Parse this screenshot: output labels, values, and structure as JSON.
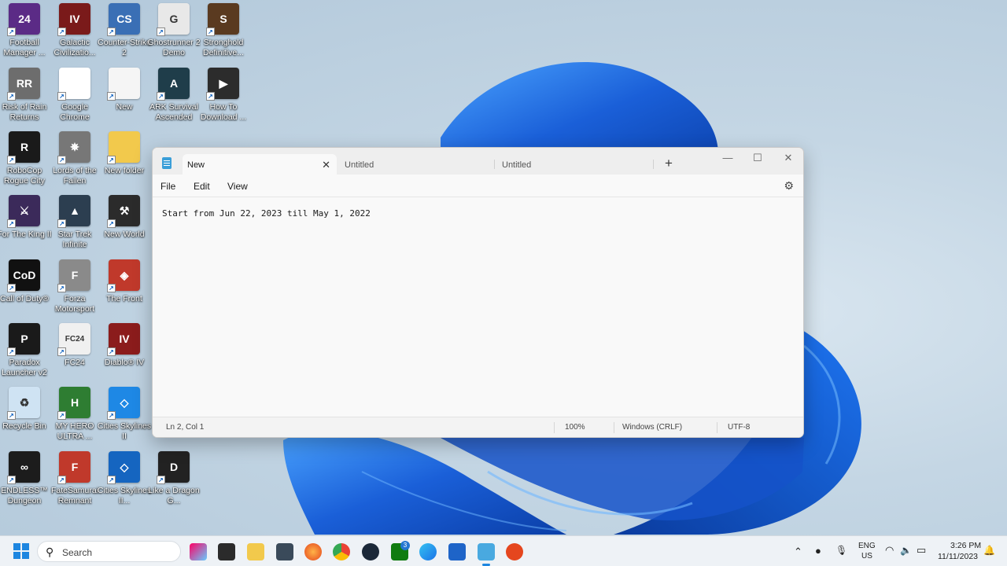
{
  "desktop": {
    "icons": [
      {
        "label": "Football Manager ...",
        "color": "#5b2b86",
        "glyph": "24"
      },
      {
        "label": "Galactic Civilizatio...",
        "color": "#7a1a1a",
        "glyph": "IV"
      },
      {
        "label": "Counter-Strike 2",
        "color": "#3a6fb5",
        "glyph": "CS"
      },
      {
        "label": "Ghostrunner 2 Demo",
        "color": "#e8e8e8",
        "glyph": "G"
      },
      {
        "label": "Stronghold Definitive...",
        "color": "#5a3a20",
        "glyph": "S"
      },
      {
        "label": "Risk of Rain Returns",
        "color": "#6d6d6d",
        "glyph": "RR"
      },
      {
        "label": "Google Chrome",
        "color": "#ffffff",
        "glyph": ""
      },
      {
        "label": "New",
        "color": "#f5f5f5",
        "glyph": ""
      },
      {
        "label": "ARK Survival Ascended",
        "color": "#1f3d4a",
        "glyph": "A"
      },
      {
        "label": "How To Download ...",
        "color": "#2c2c2c",
        "glyph": "▶"
      },
      {
        "label": "RoboCop Rogue City",
        "color": "#1a1a1a",
        "glyph": "R"
      },
      {
        "label": "Lords of the Fallen",
        "color": "#777777",
        "glyph": "✵"
      },
      {
        "label": "New folder",
        "color": "#f2c94c",
        "glyph": ""
      },
      {
        "label": "For The King II",
        "color": "#3b2a5a",
        "glyph": "⚔"
      },
      {
        "label": "Star Trek Infinite",
        "color": "#2c3e50",
        "glyph": "▲"
      },
      {
        "label": "New World",
        "color": "#2b2b2b",
        "glyph": "⚒"
      },
      {
        "label": "Call of Duty®",
        "color": "#111111",
        "glyph": "CoD"
      },
      {
        "label": "Forza Motorsport",
        "color": "#8a8a8a",
        "glyph": "F"
      },
      {
        "label": "The Front",
        "color": "#c0392b",
        "glyph": "◈"
      },
      {
        "label": "Paradox Launcher v2",
        "color": "#1a1a1a",
        "glyph": "P"
      },
      {
        "label": "FC24",
        "color": "#f0f0f0",
        "glyph": "FC24"
      },
      {
        "label": "Diablo® IV",
        "color": "#8b1c1c",
        "glyph": "IV"
      },
      {
        "label": "Recycle Bin",
        "color": "#cfe3f3",
        "glyph": "♻"
      },
      {
        "label": "MY HERO ULTRA ...",
        "color": "#2e7d32",
        "glyph": "H"
      },
      {
        "label": "Cities Skylines II",
        "color": "#1e88e5",
        "glyph": "◇"
      },
      {
        "label": "ENDLESS™ Dungeon",
        "color": "#1c1c1c",
        "glyph": "∞"
      },
      {
        "label": "FateSamurai Remnant",
        "color": "#c0392b",
        "glyph": "F"
      },
      {
        "label": "Cities Skylines II...",
        "color": "#1565c0",
        "glyph": "◇"
      },
      {
        "label": "Like a Dragon G...",
        "color": "#222222",
        "glyph": "D"
      }
    ]
  },
  "notepad": {
    "tabs": [
      "New",
      "Untitled",
      "Untitled"
    ],
    "tab_close": "✕",
    "new_tab": "+",
    "window_controls": {
      "minimize": "—",
      "maximize": "☐",
      "close": "✕"
    },
    "menu": {
      "file": "File",
      "edit": "Edit",
      "view": "View"
    },
    "settings_icon": "⚙",
    "content": "Start from Jun 22, 2023 till May 1, 2022",
    "status": {
      "position": "Ln 2, Col 1",
      "zoom": "100%",
      "line_ending": "Windows (CRLF)",
      "encoding": "UTF-8"
    }
  },
  "taskbar": {
    "search_placeholder": "Search",
    "search_icon": "⚲",
    "xbox_badge": "3",
    "language": {
      "line1": "ENG",
      "line2": "US"
    },
    "clock": {
      "time": "3:26 PM",
      "date": "11/11/2023"
    },
    "tray_chevron": "⌃",
    "tray_icons": {
      "wifi": "◠",
      "volume": "🔈",
      "battery": "▭",
      "notification": "🔔",
      "mic": "🎙",
      "steam": "●"
    }
  },
  "colors": {
    "accent": "#1d86e0",
    "wallpaper_bloom": "#1a5fd8"
  }
}
